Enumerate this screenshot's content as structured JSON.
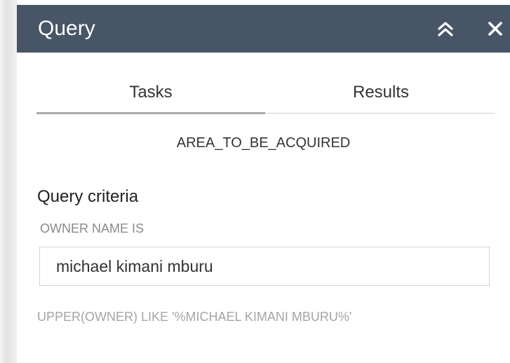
{
  "header": {
    "title": "Query"
  },
  "tabs": [
    {
      "label": "Tasks",
      "active": true
    },
    {
      "label": "Results",
      "active": false
    }
  ],
  "task": {
    "layer_name": "AREA_TO_BE_ACQUIRED",
    "criteria_title": "Query criteria",
    "field_label": "OWNER NAME IS",
    "field_value": "michael kimani mburu",
    "sql_expression": "UPPER(OWNER) LIKE '%MICHAEL KIMANI MBURU%'"
  },
  "colors": {
    "header_bg": "#485566",
    "header_text": "#ffffff",
    "active_tab_underline": "#a9a9a9"
  },
  "icons": {
    "collapse": "double-chevron-up-icon",
    "close": "close-icon"
  }
}
